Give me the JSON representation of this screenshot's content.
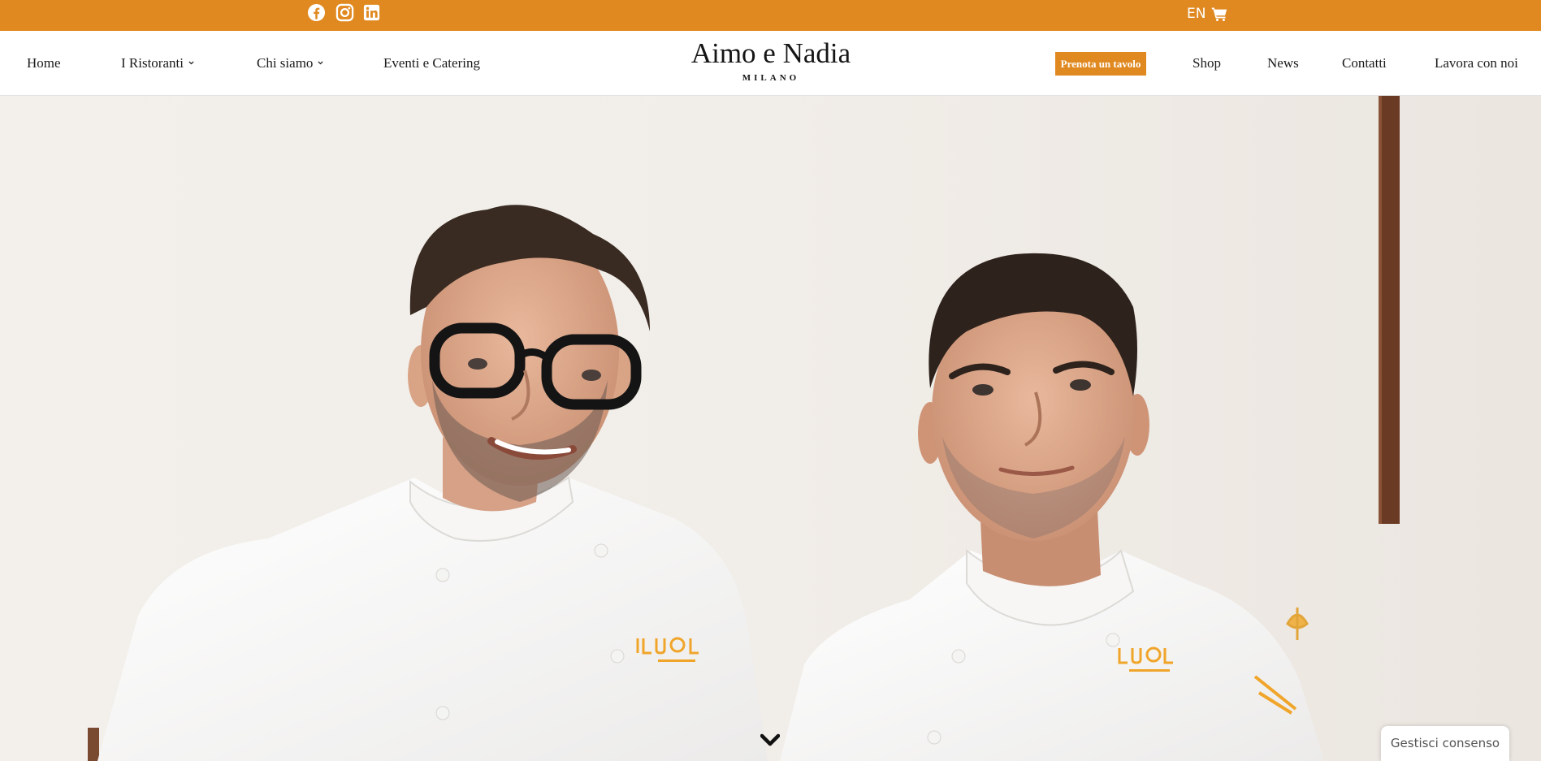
{
  "colors": {
    "accent": "#e08920",
    "nav_text": "#1b1b1b",
    "topbar_icons": "#ffffff"
  },
  "topbar": {
    "social_icons": [
      "facebook-icon",
      "instagram-icon",
      "linkedin-icon"
    ],
    "language": "EN",
    "cart_icon": "cart-icon"
  },
  "nav": {
    "left": [
      {
        "label": "Home"
      },
      {
        "label": "I Ristoranti",
        "dropdown": true
      },
      {
        "label": "Chi siamo",
        "dropdown": true
      },
      {
        "label": "Eventi e Catering"
      }
    ],
    "right": [
      {
        "label": "Shop"
      },
      {
        "label": "News"
      },
      {
        "label": "Contatti"
      },
      {
        "label": "Lavora con noi"
      }
    ],
    "cta_label": "Prenota un tavolo"
  },
  "logo": {
    "title": "Aimo e Nadia",
    "subtitle": "MILANO"
  },
  "hero": {
    "scroll_icon": "chevron-down-icon"
  },
  "consent": {
    "label": "Gestisci consenso"
  }
}
